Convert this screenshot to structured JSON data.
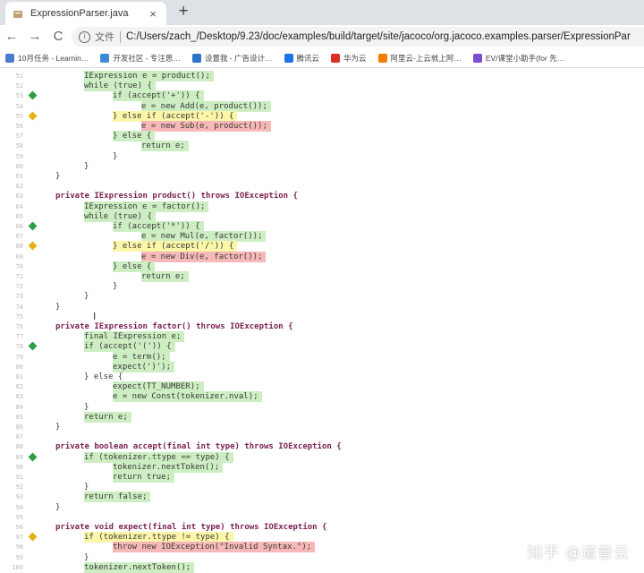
{
  "tab": {
    "title": "ExpressionParser.java",
    "close": "×",
    "new_tab": "+"
  },
  "nav": {
    "back": "←",
    "forward": "→",
    "reload": "C"
  },
  "address": {
    "scheme_label": "文件",
    "info": "i",
    "url": "C:/Users/zach_/Desktop/9.23/doc/examples/build/target/site/jacoco/org.jacoco.examples.parser/ExpressionPar"
  },
  "bookmarks": [
    {
      "label": "10月任务 - Learnin…",
      "color": "#4a7bd0"
    },
    {
      "label": "开发社区 - 专注思…",
      "color": "#3c8bd9"
    },
    {
      "label": "设置我 - 广告设计…",
      "color": "#2b74c8"
    },
    {
      "label": "腾讯云",
      "color": "#1a73e8"
    },
    {
      "label": "华为云",
      "color": "#d93025"
    },
    {
      "label": "阿里云-上云就上阿…",
      "color": "#f57c00"
    },
    {
      "label": "EV/课堂小助手(for 先…",
      "color": "#7b4dd1"
    }
  ],
  "code_lines": [
    {
      "n": "51",
      "text": "IExpression e = product();",
      "cov": "full",
      "marker": ""
    },
    {
      "n": "52",
      "text": "while (true) {",
      "cov": "full",
      "marker": ""
    },
    {
      "n": "53",
      "text": "if (accept('+')) {",
      "cov": "full",
      "marker": "green"
    },
    {
      "n": "54",
      "text": "e = new Add(e, product());",
      "cov": "full",
      "marker": ""
    },
    {
      "n": "55",
      "text": "} else if (accept('-')) {",
      "cov": "part",
      "marker": "yellow"
    },
    {
      "n": "56",
      "text": "e = new Sub(e, product());",
      "cov": "none",
      "marker": ""
    },
    {
      "n": "57",
      "text": "} else {",
      "cov": "full",
      "marker": ""
    },
    {
      "n": "58",
      "text": "return e;",
      "cov": "full",
      "marker": ""
    },
    {
      "n": "59",
      "text": "}",
      "cov": "",
      "marker": ""
    },
    {
      "n": "60",
      "text": "}",
      "cov": "",
      "marker": ""
    },
    {
      "n": "61",
      "text": "}",
      "cov": "",
      "marker": ""
    },
    {
      "n": "62",
      "text": "",
      "cov": "",
      "marker": ""
    },
    {
      "n": "63",
      "text": "private IExpression product() throws IOException {",
      "cov": "",
      "marker": ""
    },
    {
      "n": "64",
      "text": "IExpression e = factor();",
      "cov": "full",
      "marker": ""
    },
    {
      "n": "65",
      "text": "while (true) {",
      "cov": "full",
      "marker": ""
    },
    {
      "n": "66",
      "text": "if (accept('*')) {",
      "cov": "full",
      "marker": "green"
    },
    {
      "n": "67",
      "text": "e = new Mul(e, factor());",
      "cov": "full",
      "marker": ""
    },
    {
      "n": "68",
      "text": "} else if (accept('/')) {",
      "cov": "part",
      "marker": "yellow"
    },
    {
      "n": "69",
      "text": "e = new Div(e, factor());",
      "cov": "none",
      "marker": ""
    },
    {
      "n": "70",
      "text": "} else {",
      "cov": "full",
      "marker": ""
    },
    {
      "n": "71",
      "text": "return e;",
      "cov": "full",
      "marker": ""
    },
    {
      "n": "72",
      "text": "}",
      "cov": "",
      "marker": ""
    },
    {
      "n": "73",
      "text": "}",
      "cov": "",
      "marker": ""
    },
    {
      "n": "74",
      "text": "}",
      "cov": "",
      "marker": ""
    },
    {
      "n": "75",
      "text": "",
      "cov": "",
      "marker": ""
    },
    {
      "n": "76",
      "text": "private IExpression factor() throws IOException {",
      "cov": "",
      "marker": ""
    },
    {
      "n": "77",
      "text": "final IExpression e;",
      "cov": "full",
      "marker": ""
    },
    {
      "n": "78",
      "text": "if (accept('(')) {",
      "cov": "full",
      "marker": "green"
    },
    {
      "n": "79",
      "text": "e = term();",
      "cov": "full",
      "marker": ""
    },
    {
      "n": "80",
      "text": "expect(')');",
      "cov": "full",
      "marker": ""
    },
    {
      "n": "81",
      "text": "} else {",
      "cov": "",
      "marker": ""
    },
    {
      "n": "82",
      "text": "expect(TT_NUMBER);",
      "cov": "full",
      "marker": ""
    },
    {
      "n": "83",
      "text": "e = new Const(tokenizer.nval);",
      "cov": "full",
      "marker": ""
    },
    {
      "n": "84",
      "text": "}",
      "cov": "",
      "marker": ""
    },
    {
      "n": "85",
      "text": "return e;",
      "cov": "full",
      "marker": ""
    },
    {
      "n": "86",
      "text": "}",
      "cov": "",
      "marker": ""
    },
    {
      "n": "87",
      "text": "",
      "cov": "",
      "marker": ""
    },
    {
      "n": "88",
      "text": "private boolean accept(final int type) throws IOException {",
      "cov": "",
      "marker": ""
    },
    {
      "n": "89",
      "text": "if (tokenizer.ttype == type) {",
      "cov": "full",
      "marker": "green"
    },
    {
      "n": "90",
      "text": "tokenizer.nextToken();",
      "cov": "full",
      "marker": ""
    },
    {
      "n": "91",
      "text": "return true;",
      "cov": "full",
      "marker": ""
    },
    {
      "n": "92",
      "text": "}",
      "cov": "",
      "marker": ""
    },
    {
      "n": "93",
      "text": "return false;",
      "cov": "full",
      "marker": ""
    },
    {
      "n": "94",
      "text": "}",
      "cov": "",
      "marker": ""
    },
    {
      "n": "95",
      "text": "",
      "cov": "",
      "marker": ""
    },
    {
      "n": "96",
      "text": "private void expect(final int type) throws IOException {",
      "cov": "",
      "marker": ""
    },
    {
      "n": "97",
      "text": "if (tokenizer.ttype != type) {",
      "cov": "part",
      "marker": "yellow"
    },
    {
      "n": "98",
      "text": "throw new IOException(\"Invalid Syntax.\");",
      "cov": "none",
      "marker": ""
    },
    {
      "n": "99",
      "text": "}",
      "cov": "",
      "marker": ""
    },
    {
      "n": "100",
      "text": "tokenizer.nextToken();",
      "cov": "full",
      "marker": ""
    }
  ],
  "watermark": "知乎 @道普云",
  "colors": {
    "covered": "#cdeec2",
    "partly_covered": "#fbf6a8",
    "not_covered": "#f7b8b8",
    "branch_full": "#2ea043",
    "branch_partial": "#e5b210"
  }
}
